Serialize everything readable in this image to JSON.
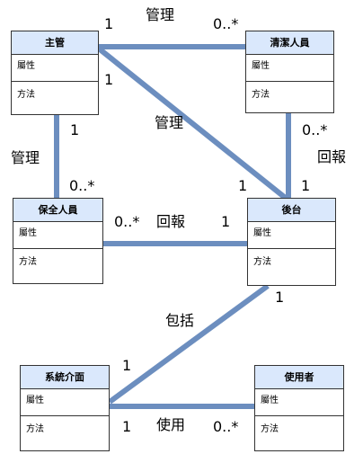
{
  "classes": {
    "supervisor": {
      "name": "主管",
      "attr": "屬性",
      "method": "方法"
    },
    "cleaner": {
      "name": "清潔人員",
      "attr": "屬性",
      "method": "方法"
    },
    "security": {
      "name": "保全人員",
      "attr": "屬性",
      "method": "方法"
    },
    "backend": {
      "name": "後台",
      "attr": "屬性",
      "method": "方法"
    },
    "system": {
      "name": "系統介面",
      "attr": "屬性",
      "method": "方法"
    },
    "user": {
      "name": "使用者",
      "attr": "屬性",
      "method": "方法"
    }
  },
  "edges": {
    "supervisor_cleaner": {
      "label": "管理",
      "from_mult": "1",
      "to_mult": "0..*"
    },
    "supervisor_backend": {
      "label": "管理",
      "from_mult": "1",
      "to_mult": "1"
    },
    "supervisor_security": {
      "label": "管理",
      "from_mult": "1",
      "to_mult": "0..*"
    },
    "cleaner_backend": {
      "label": "回報",
      "from_mult": "0..*",
      "to_mult": "1"
    },
    "security_backend": {
      "label": "回報",
      "from_mult": "0..*",
      "to_mult": "1"
    },
    "backend_system": {
      "label": "包括",
      "from_mult": "1",
      "to_mult": "1"
    },
    "system_user": {
      "label": "使用",
      "from_mult": "1",
      "to_mult": "0..*"
    }
  },
  "colors": {
    "line": "#6c8ebf",
    "header": "#dae8fc",
    "border": "#333333"
  }
}
